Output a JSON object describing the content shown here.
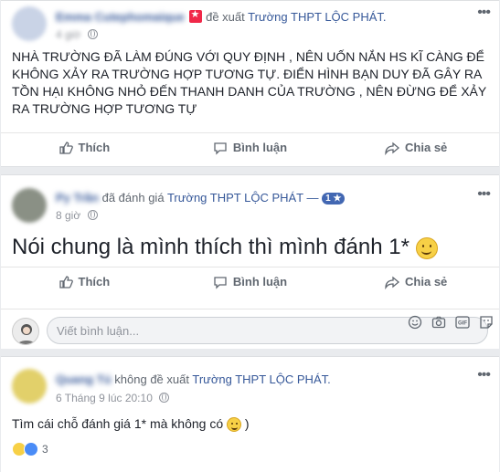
{
  "post1": {
    "author": "Emma Cutephomaique",
    "action": "đề xuất",
    "page": "Trường THPT LỘC PHÁT.",
    "time": "4 giờ",
    "body": "NHÀ TRƯỜNG ĐÃ LÀM ĐÚNG VỚI QUY ĐỊNH , NÊN UỐN NẮN HS KĨ CÀNG ĐỂ KHÔNG XẢY RA TRƯỜNG HỢP TƯƠNG TỰ. ĐIỂN HÌNH BẠN DUY ĐÃ GÂY RA TỒN HẠI KHÔNG NHỎ ĐẾN THANH DANH CỦA TRƯỜNG , NÊN ĐỪNG ĐỂ XẢY RA TRƯỜNG HỢP TƯƠNG TỰ",
    "like": "Thích",
    "comment": "Bình luận",
    "share": "Chia sẻ"
  },
  "post2": {
    "author": "Py Trần",
    "action": "đã đánh giá",
    "page": "Trường THPT LỘC PHÁT —",
    "rating": "1 ★",
    "time": "8 giờ",
    "body": "Nói chung là mình thích thì mình đánh 1*",
    "like": "Thích",
    "comment": "Bình luận",
    "share": "Chia sẻ",
    "comment_placeholder": "Viết bình luận..."
  },
  "post3": {
    "author": "Quang Tú",
    "action": "không đề xuất",
    "page": "Trường THPT LỘC PHÁT.",
    "time": "6 Tháng 9 lúc 20:10",
    "body": "Tìm cái chỗ đánh giá 1* mà không có",
    "reaction_count": "3"
  },
  "colors": {
    "link": "#365899",
    "muted": "#606770",
    "accent": "#4267b2"
  }
}
